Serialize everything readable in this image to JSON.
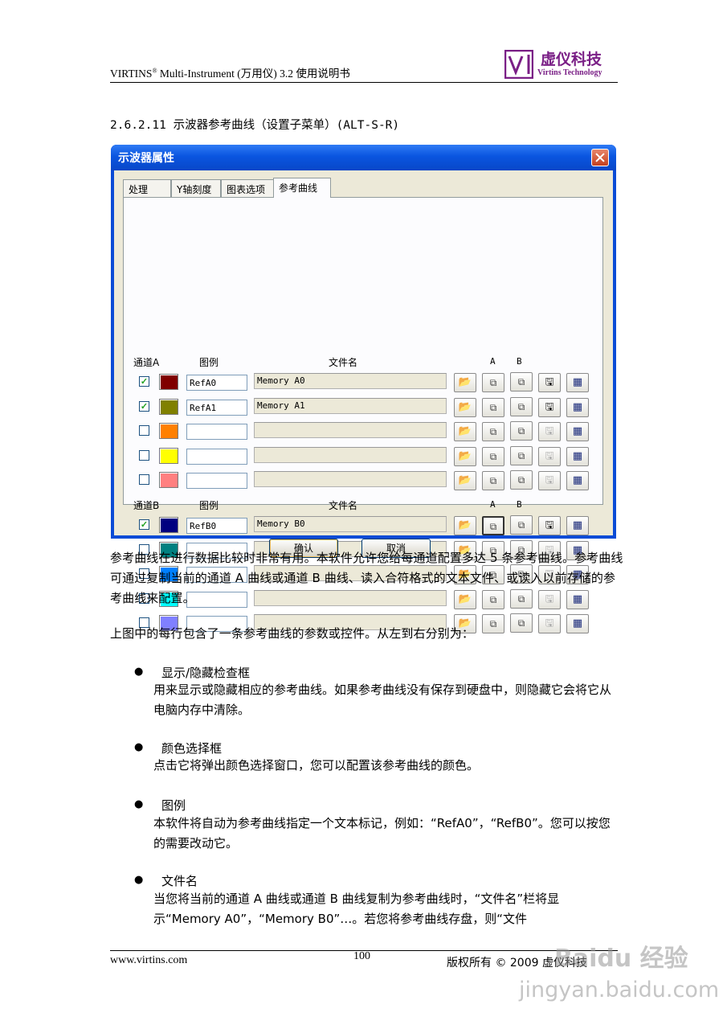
{
  "header": {
    "doc_title": "VIRTINS",
    "reg_mark": "®",
    "doc_title_rest": " Multi-Instrument (万用仪) 3.2 使用说明书",
    "logo_cn": "虚仪科技",
    "logo_en": "Virtins Technology",
    "brand_color": "#7a1f86"
  },
  "section_title": "2.6.2.11 示波器参考曲线（设置子菜单）(ALT-S-R)",
  "dialog": {
    "title": "示波器属性",
    "tabs": [
      "处理",
      "Y轴刻度",
      "图表选项",
      "参考曲线"
    ],
    "active_tab": "参考曲线",
    "channel_a_label": "通道A",
    "channel_b_label": "通道B",
    "col_legend": "图例",
    "col_filename": "文件名",
    "col_a": "A",
    "col_b": "B",
    "rows_a": [
      {
        "checked": true,
        "color": "#800000",
        "legend": "RefA0",
        "filename": "Memory A0",
        "save_enabled": true
      },
      {
        "checked": true,
        "color": "#808000",
        "legend": "RefA1",
        "filename": "Memory A1",
        "save_enabled": true
      },
      {
        "checked": false,
        "color": "#ff8000",
        "legend": "",
        "filename": "",
        "save_enabled": false
      },
      {
        "checked": false,
        "color": "#ffff00",
        "legend": "",
        "filename": "",
        "save_enabled": false
      },
      {
        "checked": false,
        "color": "#ff8080",
        "legend": "",
        "filename": "",
        "save_enabled": false
      }
    ],
    "rows_b": [
      {
        "checked": true,
        "color": "#000080",
        "legend": "RefB0",
        "filename": "Memory B0",
        "save_enabled": true
      },
      {
        "checked": false,
        "color": "#008080",
        "legend": "",
        "filename": "",
        "save_enabled": false
      },
      {
        "checked": false,
        "color": "#0080ff",
        "legend": "",
        "filename": "",
        "save_enabled": false
      },
      {
        "checked": false,
        "color": "#00ffff",
        "legend": "",
        "filename": "",
        "save_enabled": false
      },
      {
        "checked": false,
        "color": "#8080ff",
        "legend": "",
        "filename": "",
        "save_enabled": false
      }
    ],
    "ok_label": "确认",
    "cancel_label": "取消"
  },
  "body": {
    "para1": "参考曲线在进行数据比较时非常有用。本软件允许您给每通道配置多达 5 条参考曲线。参考曲线可通过复制当前的通道 A 曲线或通道 B 曲线、读入合符格式的文本文件、或读入以前存储的参考曲线来配置。",
    "para2": "上图中的每行包含了一条参考曲线的参数或控件。从左到右分别为：",
    "bullets": [
      {
        "title": "显示/隐藏检查框",
        "text": "用来显示或隐藏相应的参考曲线。如果参考曲线没有保存到硬盘中，则隐藏它会将它从电脑内存中清除。"
      },
      {
        "title": "颜色选择框",
        "text": "点击它将弹出颜色选择窗口，您可以配置该参考曲线的颜色。"
      },
      {
        "title": "图例",
        "text": "本软件将自动为参考曲线指定一个文本标记，例如：“RefA0”，“RefB0”。您可以按您的需要改动它。"
      },
      {
        "title": "文件名",
        "text": "当您将当前的通道 A 曲线或通道 B 曲线复制为参考曲线时，“文件名”栏将显示“Memory  A0”，“Memory  B0”…。若您将参考曲线存盘，则“文件"
      }
    ]
  },
  "footer": {
    "website": "www.virtins.com",
    "page_number": "100",
    "copyright": "版权所有 © 2009 虚仪科技",
    "watermark": "Baidu 经验",
    "watermark_url": "jingyan.baidu.com"
  }
}
